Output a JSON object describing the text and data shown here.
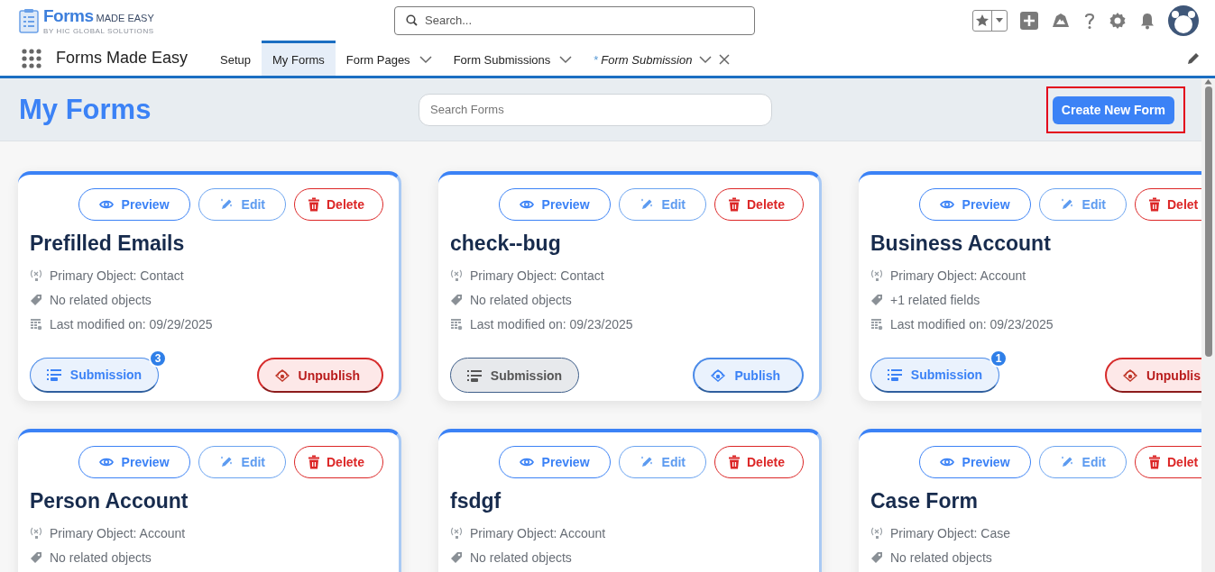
{
  "header": {
    "logo": {
      "name": "Forms",
      "tagline": "MADE EASY",
      "byline": "BY HIC GLOBAL SOLUTIONS"
    },
    "search": {
      "placeholder": "Search..."
    }
  },
  "nav": {
    "app_name": "Forms Made Easy",
    "tabs": [
      {
        "label": "Setup",
        "selected": false,
        "kind": "plain"
      },
      {
        "label": "My Forms",
        "selected": true,
        "kind": "plain"
      },
      {
        "label": "Form Pages",
        "selected": false,
        "kind": "menu"
      },
      {
        "label": "Form Submissions",
        "selected": false,
        "kind": "menu"
      },
      {
        "label": "Form Submission",
        "prefix": "*",
        "selected": false,
        "kind": "record"
      }
    ]
  },
  "page": {
    "title": "My Forms",
    "search": {
      "placeholder": "Search Forms"
    },
    "create_button": {
      "label": "Create New Form",
      "highlighted": true
    }
  },
  "cards": [
    {
      "title": "Prefilled Emails",
      "actions": [
        {
          "kind": "preview",
          "label": "Preview"
        },
        {
          "kind": "edit",
          "label": "Edit"
        },
        {
          "kind": "delete",
          "label": "Delete"
        }
      ],
      "meta": [
        {
          "kind": "object",
          "text": "Primary Object: Contact"
        },
        {
          "kind": "related",
          "text": "No related objects"
        },
        {
          "kind": "date",
          "text": "Last modified on: 09/29/2025"
        }
      ],
      "submission": {
        "label": "Submission",
        "badge": "3"
      },
      "publish": {
        "label": "Unpublish",
        "published": true
      }
    },
    {
      "title": "check--bug",
      "actions": [
        {
          "kind": "preview",
          "label": "Preview"
        },
        {
          "kind": "edit",
          "label": "Edit"
        },
        {
          "kind": "delete",
          "label": "Delete"
        }
      ],
      "meta": [
        {
          "kind": "object",
          "text": "Primary Object: Contact"
        },
        {
          "kind": "related",
          "text": "No related objects"
        },
        {
          "kind": "date",
          "text": "Last modified on: 09/23/2025"
        }
      ],
      "submission": {
        "label": "Submission"
      },
      "publish": {
        "label": "Publish",
        "published": false
      }
    },
    {
      "title": "Business Account",
      "actions": [
        {
          "kind": "preview",
          "label": "Preview"
        },
        {
          "kind": "edit",
          "label": "Edit"
        },
        {
          "kind": "delete",
          "label": "Delet"
        }
      ],
      "meta": [
        {
          "kind": "object",
          "text": "Primary Object: Account"
        },
        {
          "kind": "related",
          "text": "+1 related fields"
        },
        {
          "kind": "date",
          "text": "Last modified on: 09/23/2025"
        }
      ],
      "submission": {
        "label": "Submission",
        "badge": "1"
      },
      "publish": {
        "label": "Unpublis",
        "published": true
      }
    },
    {
      "title": "Person Account",
      "actions": [
        {
          "kind": "preview",
          "label": "Preview"
        },
        {
          "kind": "edit",
          "label": "Edit"
        },
        {
          "kind": "delete",
          "label": "Delete"
        }
      ],
      "meta": [
        {
          "kind": "object",
          "text": "Primary Object: Account"
        },
        {
          "kind": "related",
          "text": "No related objects"
        }
      ]
    },
    {
      "title": "fsdgf",
      "actions": [
        {
          "kind": "preview",
          "label": "Preview"
        },
        {
          "kind": "edit",
          "label": "Edit"
        },
        {
          "kind": "delete",
          "label": "Delete"
        }
      ],
      "meta": [
        {
          "kind": "object",
          "text": "Primary Object: Account"
        },
        {
          "kind": "related",
          "text": "No related objects"
        }
      ]
    },
    {
      "title": "Case Form",
      "actions": [
        {
          "kind": "preview",
          "label": "Preview"
        },
        {
          "kind": "edit",
          "label": "Edit"
        },
        {
          "kind": "delete",
          "label": "Delet"
        }
      ],
      "meta": [
        {
          "kind": "object",
          "text": "Primary Object: Case"
        },
        {
          "kind": "related",
          "text": "No related objects"
        }
      ]
    }
  ]
}
